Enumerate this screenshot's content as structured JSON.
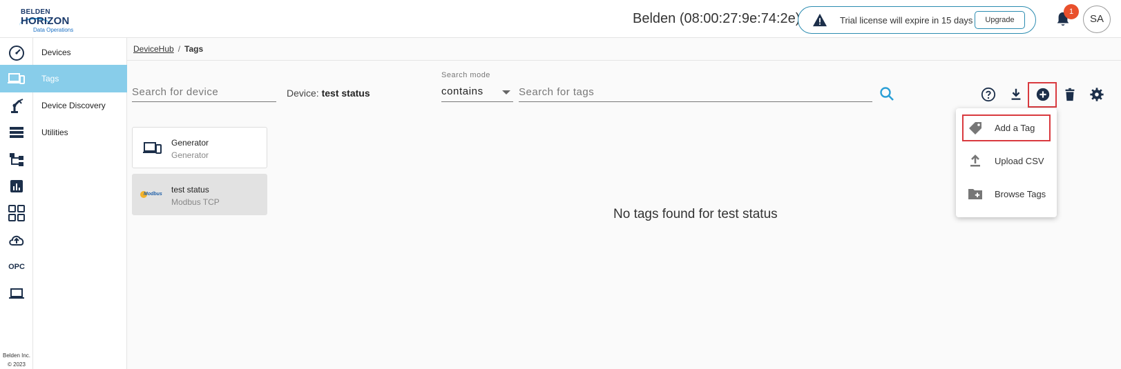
{
  "header": {
    "logo": {
      "line1": "BELDEN",
      "line2": "HORIZON",
      "line3": "Data Operations"
    },
    "device_id": "Belden (08:00:27:9e:74:2e)",
    "license_text": "Trial license will expire in 15 days",
    "upgrade_label": "Upgrade",
    "notification_count": "1",
    "avatar_initials": "SA"
  },
  "rail": {
    "items": [
      "dashboard-icon",
      "devices-icon",
      "robot-arm-icon",
      "list-icon",
      "hierarchy-icon",
      "chart-icon",
      "grid-icon",
      "cloud-upload-icon",
      "opc",
      "laptop-icon"
    ],
    "opc_label": "OPC",
    "copyright_line1": "Belden Inc.",
    "copyright_line2": "© 2023"
  },
  "subnav": {
    "items": [
      {
        "label": "Devices"
      },
      {
        "label": "Tags"
      },
      {
        "label": "Device Discovery"
      },
      {
        "label": "Utilities"
      }
    ]
  },
  "breadcrumb": {
    "root": "DeviceHub",
    "separator": "/",
    "current": "Tags"
  },
  "toolbar": {
    "device_search_placeholder": "Search for device",
    "device_label": "Device:",
    "device_value": "test status",
    "search_mode_label": "Search mode",
    "search_mode_value": "contains",
    "tag_search_placeholder": "Search for tags"
  },
  "devices": [
    {
      "name": "Generator",
      "type": "Generator"
    },
    {
      "name": "test status",
      "type": "Modbus TCP",
      "logo_text": "Modbus"
    }
  ],
  "empty_message": "No tags found for test status",
  "add_menu": {
    "items": [
      {
        "label": "Add a Tag"
      },
      {
        "label": "Upload CSV"
      },
      {
        "label": "Browse Tags"
      }
    ]
  },
  "colors": {
    "accent_active": "#88cdea",
    "navy_icon": "#1c2f4a",
    "highlight": "#d9393e",
    "badge": "#e9502c",
    "border_accent": "#2a8bb0"
  }
}
